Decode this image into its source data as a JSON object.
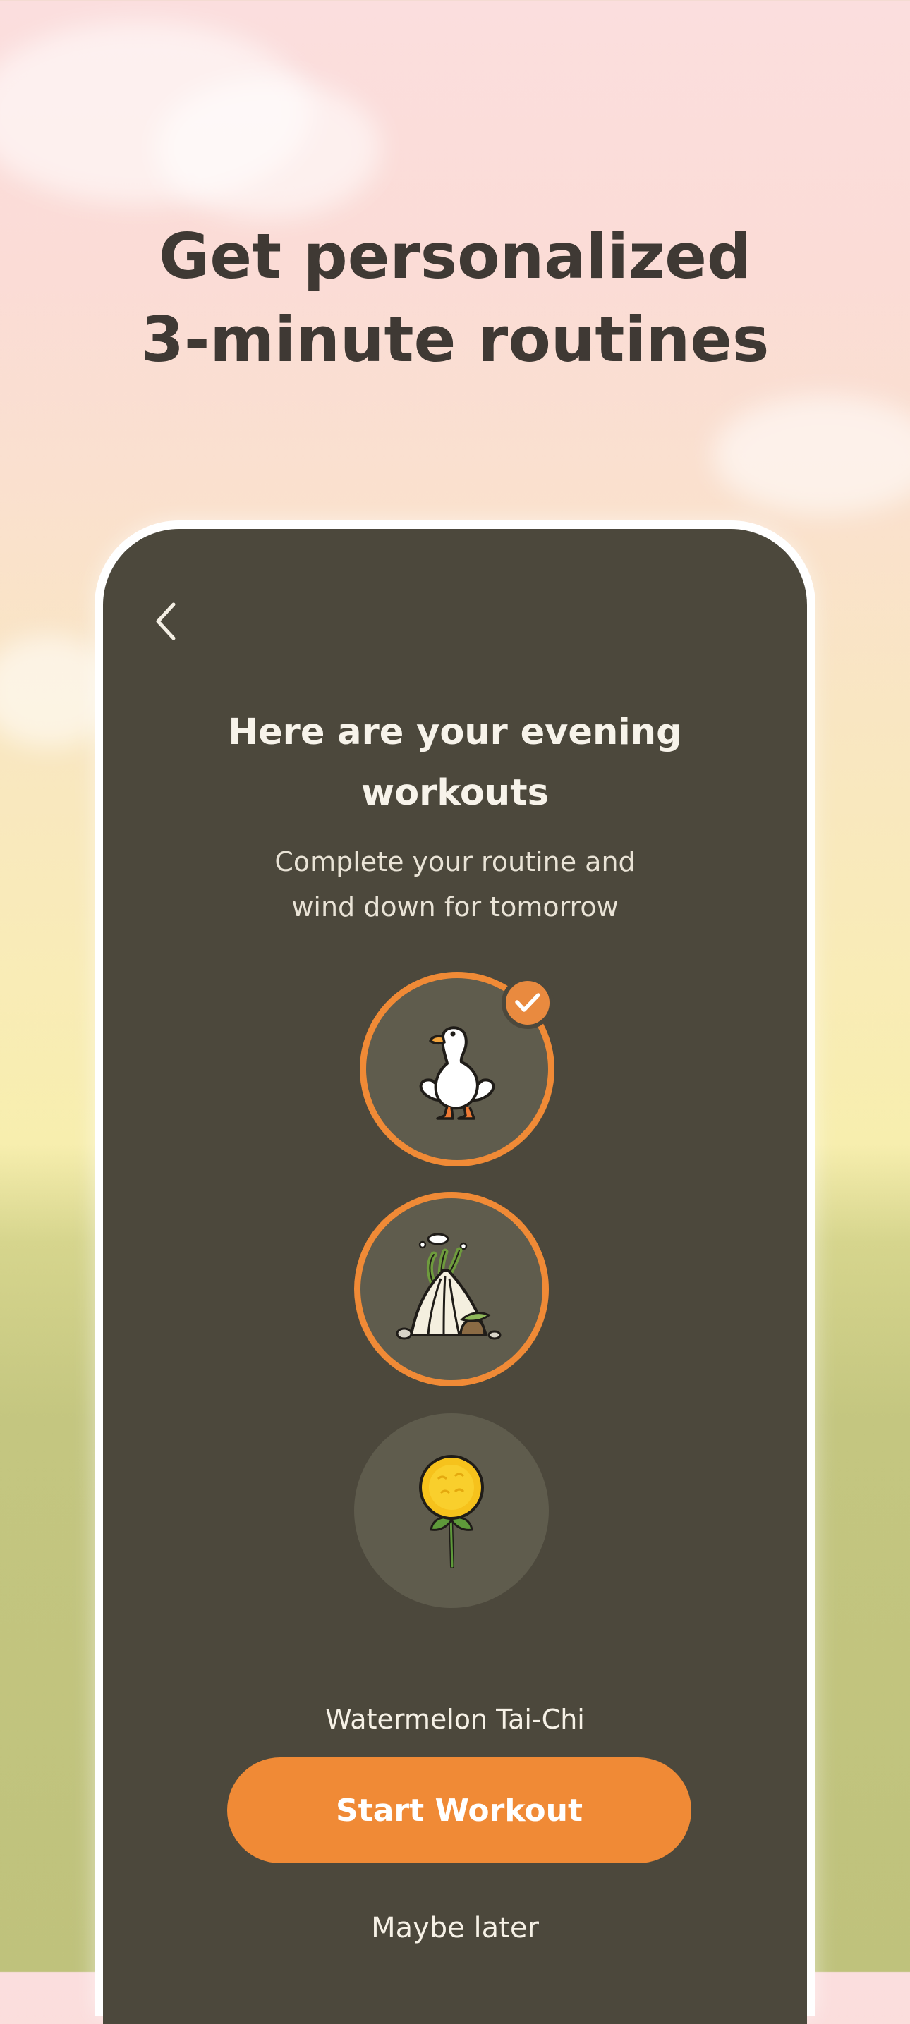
{
  "headline": {
    "line1": "Get personalized",
    "line2": "3-minute routines"
  },
  "screen": {
    "back_icon": "chevron-left-icon",
    "title_line1": "Here are your evening",
    "title_line2": "workouts",
    "subtitle_line1": "Complete your routine and",
    "subtitle_line2": "wind down for tomorrow",
    "workouts": [
      {
        "icon": "duck-icon",
        "state": "completed",
        "badge_icon": "check-icon"
      },
      {
        "icon": "hut-icon",
        "state": "current"
      },
      {
        "icon": "dandelion-flower-icon",
        "state": "upcoming"
      }
    ],
    "routine_name": "Watermelon Tai-Chi",
    "start_button_label": "Start Workout",
    "maybe_later_label": "Maybe later"
  },
  "colors": {
    "accent": "#f08a36",
    "screen_bg": "#4c483c",
    "headline": "#3f3934",
    "circle_fill": "#5f5c4d"
  }
}
